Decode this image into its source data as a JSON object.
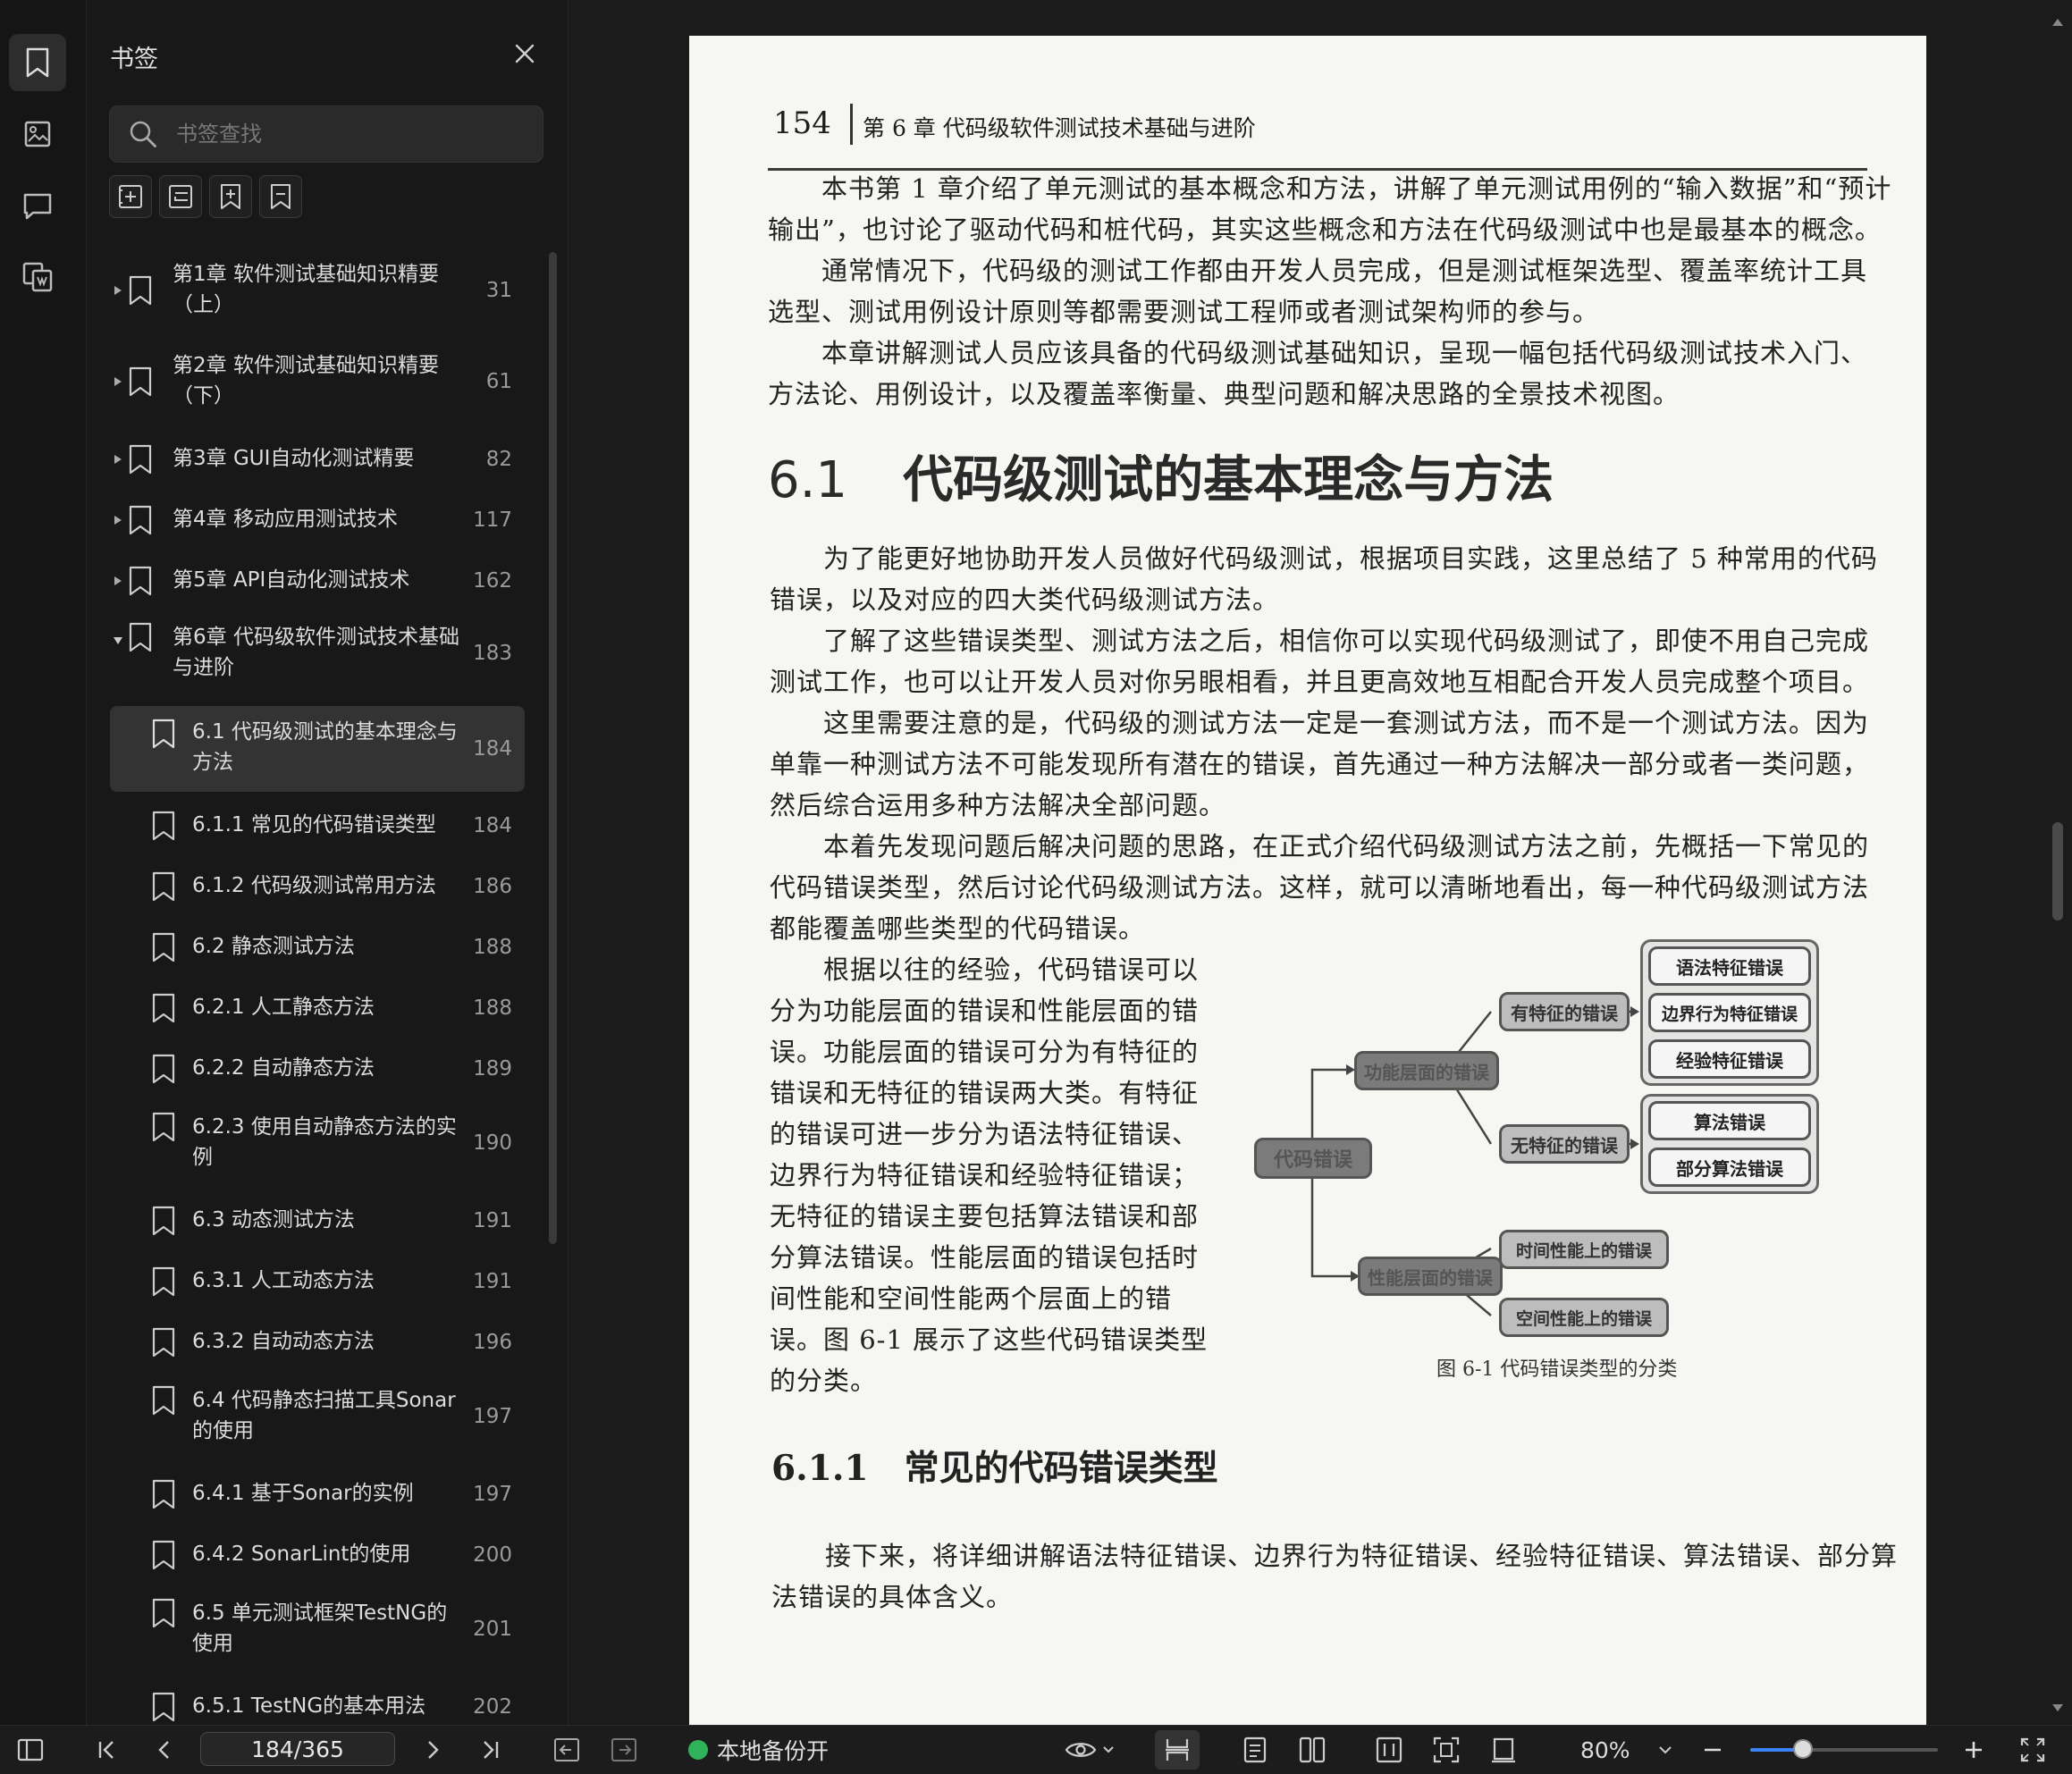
{
  "rail": {
    "items": [
      {
        "icon": "bookmark-icon",
        "active": true
      },
      {
        "icon": "image-icon",
        "active": false
      },
      {
        "icon": "comment-icon",
        "active": false
      },
      {
        "icon": "thumbnail-icon",
        "active": false
      }
    ]
  },
  "bookmarks_panel": {
    "title": "书签",
    "search_placeholder": "书签查找",
    "tools": [
      "add-bookmark-icon",
      "add-sub-bookmark-icon",
      "bookmark-insert-icon",
      "bookmark-remove-icon"
    ],
    "items": [
      {
        "label": "第1章  软件测试基础知识精要（上）",
        "page": "31",
        "expandable": true,
        "expanded": false,
        "level": 0
      },
      {
        "label": "第2章  软件测试基础知识精要（下）",
        "page": "61",
        "expandable": true,
        "expanded": false,
        "level": 0
      },
      {
        "label": "第3章  GUI自动化测试精要",
        "page": "82",
        "expandable": true,
        "expanded": false,
        "level": 0
      },
      {
        "label": "第4章  移动应用测试技术",
        "page": "117",
        "expandable": true,
        "expanded": false,
        "level": 0
      },
      {
        "label": "第5章  API自动化测试技术",
        "page": "162",
        "expandable": true,
        "expanded": false,
        "level": 0
      },
      {
        "label": "第6章  代码级软件测试技术基础与进阶",
        "page": "183",
        "expandable": true,
        "expanded": true,
        "level": 0
      },
      {
        "label": "6.1  代码级测试的基本理念与方法",
        "page": "184",
        "expandable": false,
        "level": 1,
        "selected": true
      },
      {
        "label": "6.1.1  常见的代码错误类型",
        "page": "184",
        "expandable": false,
        "level": 1
      },
      {
        "label": "6.1.2  代码级测试常用方法",
        "page": "186",
        "expandable": false,
        "level": 1
      },
      {
        "label": "6.2  静态测试方法",
        "page": "188",
        "expandable": false,
        "level": 1
      },
      {
        "label": "6.2.1  人工静态方法",
        "page": "188",
        "expandable": false,
        "level": 1
      },
      {
        "label": "6.2.2  自动静态方法",
        "page": "189",
        "expandable": false,
        "level": 1
      },
      {
        "label": "6.2.3  使用自动静态方法的实例",
        "page": "190",
        "expandable": false,
        "level": 1
      },
      {
        "label": "6.3  动态测试方法",
        "page": "191",
        "expandable": false,
        "level": 1
      },
      {
        "label": "6.3.1  人工动态方法",
        "page": "191",
        "expandable": false,
        "level": 1
      },
      {
        "label": "6.3.2  自动动态方法",
        "page": "196",
        "expandable": false,
        "level": 1
      },
      {
        "label": "6.4  代码静态扫描工具Sonar的使用",
        "page": "197",
        "expandable": false,
        "level": 1
      },
      {
        "label": "6.4.1  基于Sonar的实例",
        "page": "197",
        "expandable": false,
        "level": 1
      },
      {
        "label": "6.4.2  SonarLint的使用",
        "page": "200",
        "expandable": false,
        "level": 1
      },
      {
        "label": "6.5  单元测试框架TestNG的使用",
        "page": "201",
        "expandable": false,
        "level": 1
      },
      {
        "label": "6.5.1  TestNG的基本用法",
        "page": "202",
        "expandable": false,
        "level": 1
      }
    ]
  },
  "document": {
    "page_number": "154",
    "running_header": "第 6 章    代码级软件测试技术基础与进阶",
    "intro_paragraphs": [
      "本书第 1 章介绍了单元测试的基本概念和方法，讲解了单元测试用例的“输入数据”和“预计输出”，也讨论了驱动代码和桩代码，其实这些概念和方法在代码级测试中也是最基本的概念。",
      "通常情况下，代码级的测试工作都由开发人员完成，但是测试框架选型、覆盖率统计工具选型、测试用例设计原则等都需要测试工程师或者测试架构师的参与。",
      "本章讲解测试人员应该具备的代码级测试基础知识，呈现一幅包括代码级测试技术入门、方法论、用例设计，以及覆盖率衡量、典型问题和解决思路的全景技术视图。"
    ],
    "section_number": "6.1",
    "section_title": "代码级测试的基本理念与方法",
    "section_paragraphs": [
      "为了能更好地协助开发人员做好代码级测试，根据项目实践，这里总结了 5 种常用的代码错误，以及对应的四大类代码级测试方法。",
      "了解了这些错误类型、测试方法之后，相信你可以实现代码级测试了，即使不用自己完成测试工作，也可以让开发人员对你另眼相看，并且更高效地互相配合开发人员完成整个项目。",
      "这里需要注意的是，代码级的测试方法一定是一套测试方法，而不是一个测试方法。因为单靠一种测试方法不可能发现所有潜在的错误，首先通过一种方法解决一部分或者一类问题，然后综合运用多种方法解决全部问题。",
      "本着先发现问题后解决问题的思路，在正式介绍代码级测试方法之前，先概括一下常见的代码错误类型，然后讨论代码级测试方法。这样，就可以清晰地看出，每一种代码级测试方法都能覆盖哪些类型的代码错误。"
    ],
    "side_paragraph": "根据以往的经验，代码错误可以分为功能层面的错误和性能层面的错误。功能层面的错误可分为有特征的错误和无特征的错误两大类。有特征的错误可进一步分为语法特征错误、边界行为特征错误和经验特征错误；无特征的错误主要包括算法错误和部分算法错误。性能层面的错误包括时间性能和空间性能两个层面上的错误。图 6-1 展示了这些代码错误类型的分类。",
    "figure": {
      "caption": "图 6-1    代码错误类型的分类",
      "root": "代码错误",
      "functional": "功能层面的错误",
      "performance": "性能层面的错误",
      "featured": "有特征的错误",
      "featureless": "无特征的错误",
      "syntax": "语法特征错误",
      "boundary": "边界行为特征错误",
      "experience": "经验特征错误",
      "algorithm": "算法错误",
      "partial_algorithm": "部分算法错误",
      "time_perf": "时间性能上的错误",
      "space_perf": "空间性能上的错误"
    },
    "subsection_number": "6.1.1",
    "subsection_title": "常见的代码错误类型",
    "subsection_paragraph": "接下来，将详细讲解语法特征错误、边界行为特征错误、经验特征错误、算法错误、部分算法错误的具体含义。"
  },
  "bottom_bar": {
    "page_indicator": "184/365",
    "backup_label": "本地备份开",
    "zoom": "80%",
    "zoom_fraction": 0.28
  }
}
